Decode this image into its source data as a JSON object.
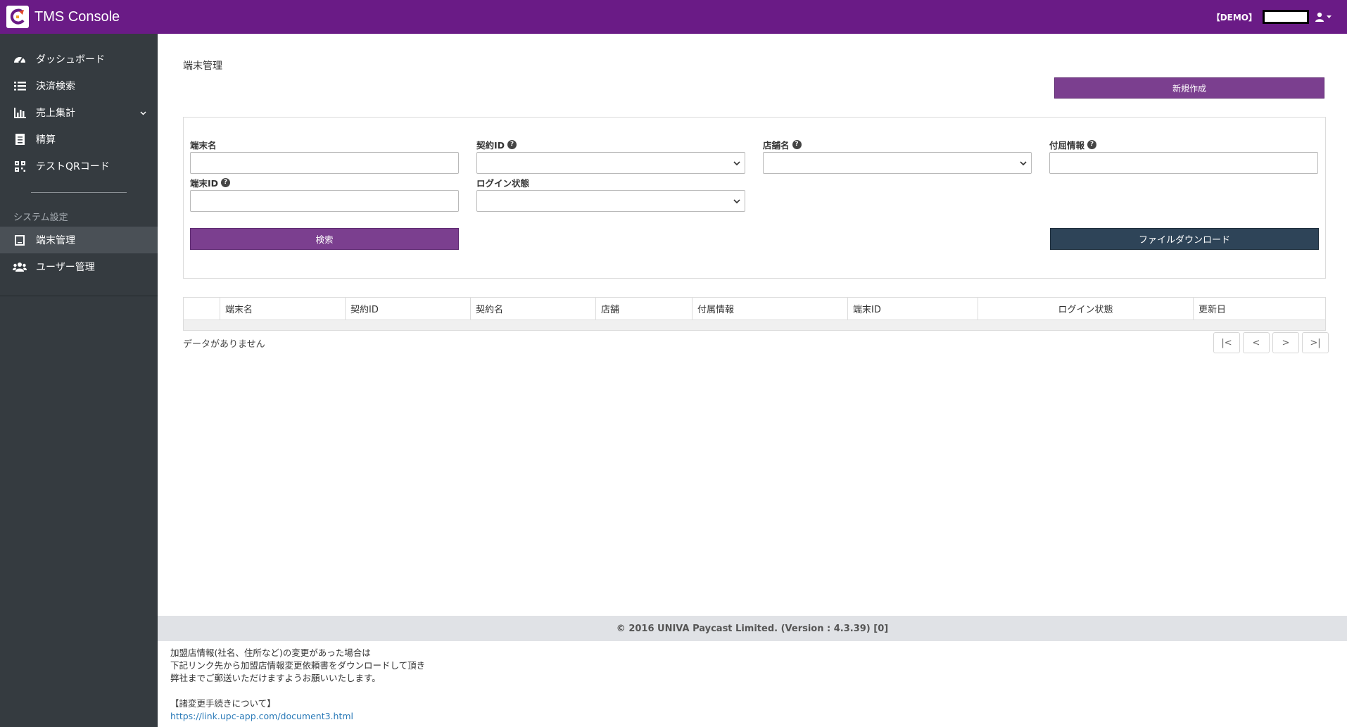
{
  "header": {
    "app_title": "TMS Console",
    "demo_badge": "【DEMO】",
    "user_name": ""
  },
  "sidebar": {
    "items": [
      {
        "label": "ダッシュボード",
        "icon": "dashboard-icon"
      },
      {
        "label": "決済検索",
        "icon": "list-icon"
      },
      {
        "label": "売上集計",
        "icon": "bar-chart-icon"
      },
      {
        "label": "精算",
        "icon": "receipt-icon"
      },
      {
        "label": "テストQRコード",
        "icon": "qrcode-icon"
      }
    ],
    "section_label": "システム設定",
    "system_items": [
      {
        "label": "端末管理",
        "icon": "tablet-icon",
        "active": true
      },
      {
        "label": "ユーザー管理",
        "icon": "users-icon"
      }
    ]
  },
  "main": {
    "page_title": "端末管理",
    "new_button": "新規作成",
    "search": {
      "terminal_name_label": "端末名",
      "terminal_name_value": "",
      "contract_id_label": "契約ID",
      "contract_id_value": "",
      "store_name_label": "店舗名",
      "store_name_value": "",
      "attached_info_label": "付屈情報",
      "attached_info_value": "",
      "terminal_id_label": "端末ID",
      "terminal_id_value": "",
      "login_state_label": "ログイン状態",
      "login_state_value": "",
      "search_button": "検索",
      "download_button": "ファイルダウンロード"
    },
    "table": {
      "columns": [
        "",
        "端末名",
        "契約ID",
        "契約名",
        "店舗",
        "付属情報",
        "端末ID",
        "ログイン状態",
        "更新日"
      ],
      "rows": [],
      "no_data": "データがありません"
    },
    "pager": {
      "first": "|<",
      "prev": "<",
      "next": ">",
      "last": ">|"
    }
  },
  "footer": {
    "copyright": "© 2016 UNIVA Paycast Limited. (Version : 4.3.39) [0]",
    "notice_lines": [
      "加盟店情報(社名、住所など)の変更があった場合は",
      "下記リンク先から加盟店情報変更依頼書をダウンロードして頂き",
      "弊社までご郵送いただけますようお願いいたします。"
    ],
    "notice_heading": "【諸変更手続きについて】",
    "notice_link": "https://link.upc-app.com/document3.html"
  },
  "colors": {
    "header_bg": "#6a1b86",
    "sidebar_bg": "#353b40",
    "primary_button": "#7b3f8f",
    "download_button": "#2e4458"
  }
}
